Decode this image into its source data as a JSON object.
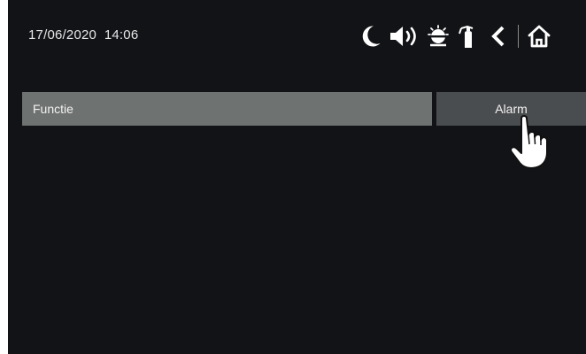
{
  "status_bar": {
    "date": "17/06/2020",
    "time": "14:06",
    "icons": [
      "moon-icon",
      "speaker-icon",
      "alarm-siren-icon",
      "fire-extinguisher-icon",
      "back-chevron-icon",
      "home-icon"
    ]
  },
  "menu": {
    "row_label": "Functie",
    "action_label": "Alarm"
  },
  "colors": {
    "background": "#111316",
    "label_cell": "#6e7270",
    "action_cell": "#4a4d4f",
    "text": "#f2f2f2"
  }
}
